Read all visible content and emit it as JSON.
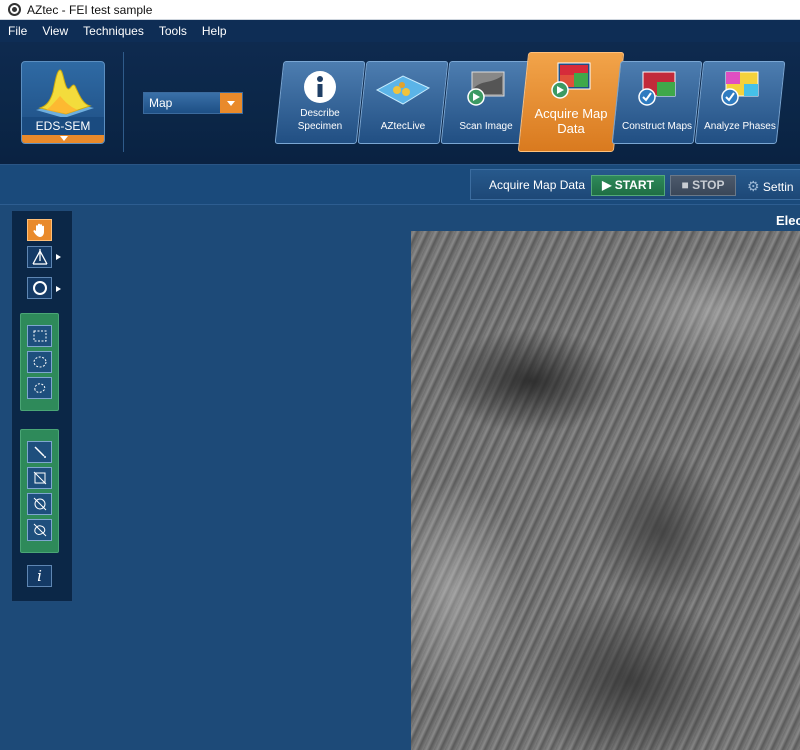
{
  "window": {
    "title": "AZtec - FEI test sample"
  },
  "menu": {
    "items": [
      "File",
      "View",
      "Techniques",
      "Tools",
      "Help"
    ]
  },
  "technique": {
    "label": "EDS-SEM"
  },
  "mode": {
    "value": "Map"
  },
  "workflow": {
    "steps": [
      {
        "label": "Describe Specimen",
        "icon": "info-icon"
      },
      {
        "label": "AZtecLive",
        "icon": "live-icon"
      },
      {
        "label": "Scan Image",
        "icon": "scan-icon"
      },
      {
        "label": "Acquire Map Data",
        "icon": "acquire-map-icon",
        "active": true
      },
      {
        "label": "Construct Maps",
        "icon": "construct-maps-icon"
      },
      {
        "label": "Analyze Phases",
        "icon": "analyze-phases-icon"
      }
    ]
  },
  "acquisition": {
    "label": "Acquire Map Data",
    "start_label": "START",
    "stop_label": "STOP",
    "settings_label": "Settin"
  },
  "image_panel": {
    "title": "Elec"
  },
  "colors": {
    "accent": "#e98a2b",
    "start_green": "#2e8a5a",
    "background": "#1d4a78",
    "menubar": "#0e2d55"
  }
}
